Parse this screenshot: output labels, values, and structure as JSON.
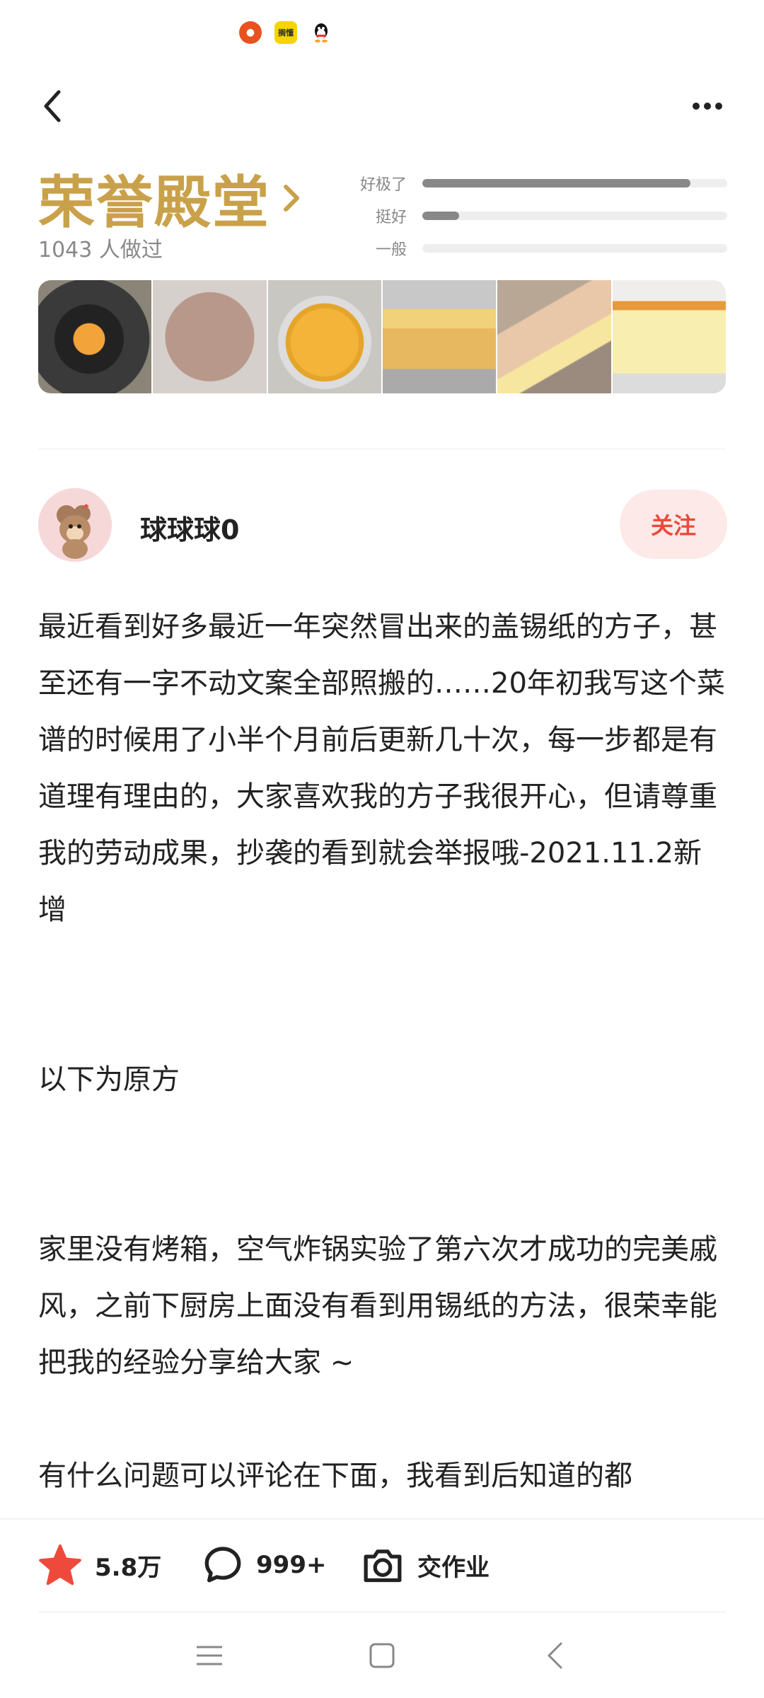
{
  "status_bar": {
    "icons": [
      "app-notification-icon",
      "yellow-app-icon",
      "qq-icon"
    ],
    "yellow_app_text": "搁懂"
  },
  "nav": {
    "back_icon": "chevron-left-icon",
    "more_icon": "more-dots-icon"
  },
  "honor": {
    "title": "荣誉殿堂",
    "made_count": "1043 人做过",
    "ratings": [
      {
        "label": "好极了",
        "level": 0.88
      },
      {
        "label": "挺好",
        "level": 0.12
      },
      {
        "label": "一般",
        "level": 0.0
      }
    ]
  },
  "photos": [
    {
      "name": "photo-air-fryer-cake"
    },
    {
      "name": "photo-cake-top"
    },
    {
      "name": "photo-orange-cake"
    },
    {
      "name": "photo-cake-on-rack"
    },
    {
      "name": "photo-cake-slice-hand"
    },
    {
      "name": "photo-sponge-cake-cut"
    }
  ],
  "author": {
    "name": "球球球0",
    "follow_label": "关注"
  },
  "content": {
    "p1": "最近看到好多最近一年突然冒出来的盖锡纸的方子，甚至还有一字不动文案全部照搬的……20年初我写这个菜谱的时候用了小半个月前后更新几十次，每一步都是有道理有理由的，大家喜欢我的方子我很开心，但请尊重我的劳动成果，抄袭的看到就会举报哦-2021.11.2新增",
    "p2": "以下为原方",
    "p3": "家里没有烤箱，空气炸锅实验了第六次才成功的完美戚风，之前下厨房上面没有看到用锡纸的方法，很荣幸能把我的经验分享给大家 ~",
    "p4": "有什么问题可以评论在下面，我看到后知道的都"
  },
  "bottom_bar": {
    "favorite_count": "5.8万",
    "comment_count": "999+",
    "homework_label": "交作业",
    "accent_color": "#ee4a3c"
  },
  "system_nav": {
    "icons": [
      "menu-icon",
      "home-square-icon",
      "back-triangle-icon"
    ]
  }
}
